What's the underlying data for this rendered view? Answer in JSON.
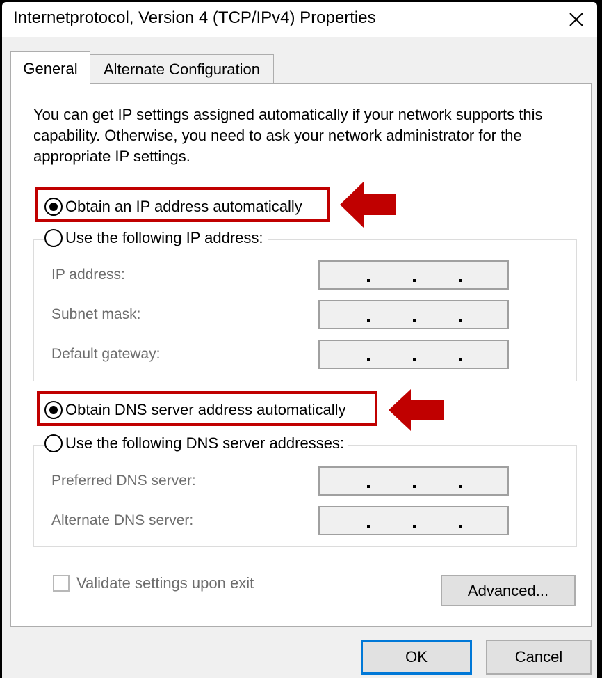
{
  "window": {
    "title": "Internetprotocol, Version 4 (TCP/IPv4) Properties",
    "close_glyph": "✕"
  },
  "tabs": [
    {
      "label": "General",
      "active": true
    },
    {
      "label": "Alternate Configuration",
      "active": false
    }
  ],
  "general": {
    "description": "You can get IP settings assigned automatically if your network supports this capability. Otherwise, you need to ask your network administrator for the appropriate IP settings.",
    "ip_auto_label": "Obtain an IP address automatically",
    "ip_manual_label": "Use the following IP address:",
    "ip_fields": [
      {
        "label": "IP address:"
      },
      {
        "label": "Subnet mask:"
      },
      {
        "label": "Default gateway:"
      }
    ],
    "dns_auto_label": "Obtain DNS server address automatically",
    "dns_manual_label": "Use the following DNS server addresses:",
    "dns_fields": [
      {
        "label": "Preferred DNS server:"
      },
      {
        "label": "Alternate DNS server:"
      }
    ],
    "validate_label": "Validate settings upon exit",
    "validate_checked": false,
    "advanced_label": "Advanced..."
  },
  "footer": {
    "ok_label": "OK",
    "cancel_label": "Cancel"
  },
  "colors": {
    "highlight": "#c00000",
    "default_button_border": "#0078d7"
  }
}
